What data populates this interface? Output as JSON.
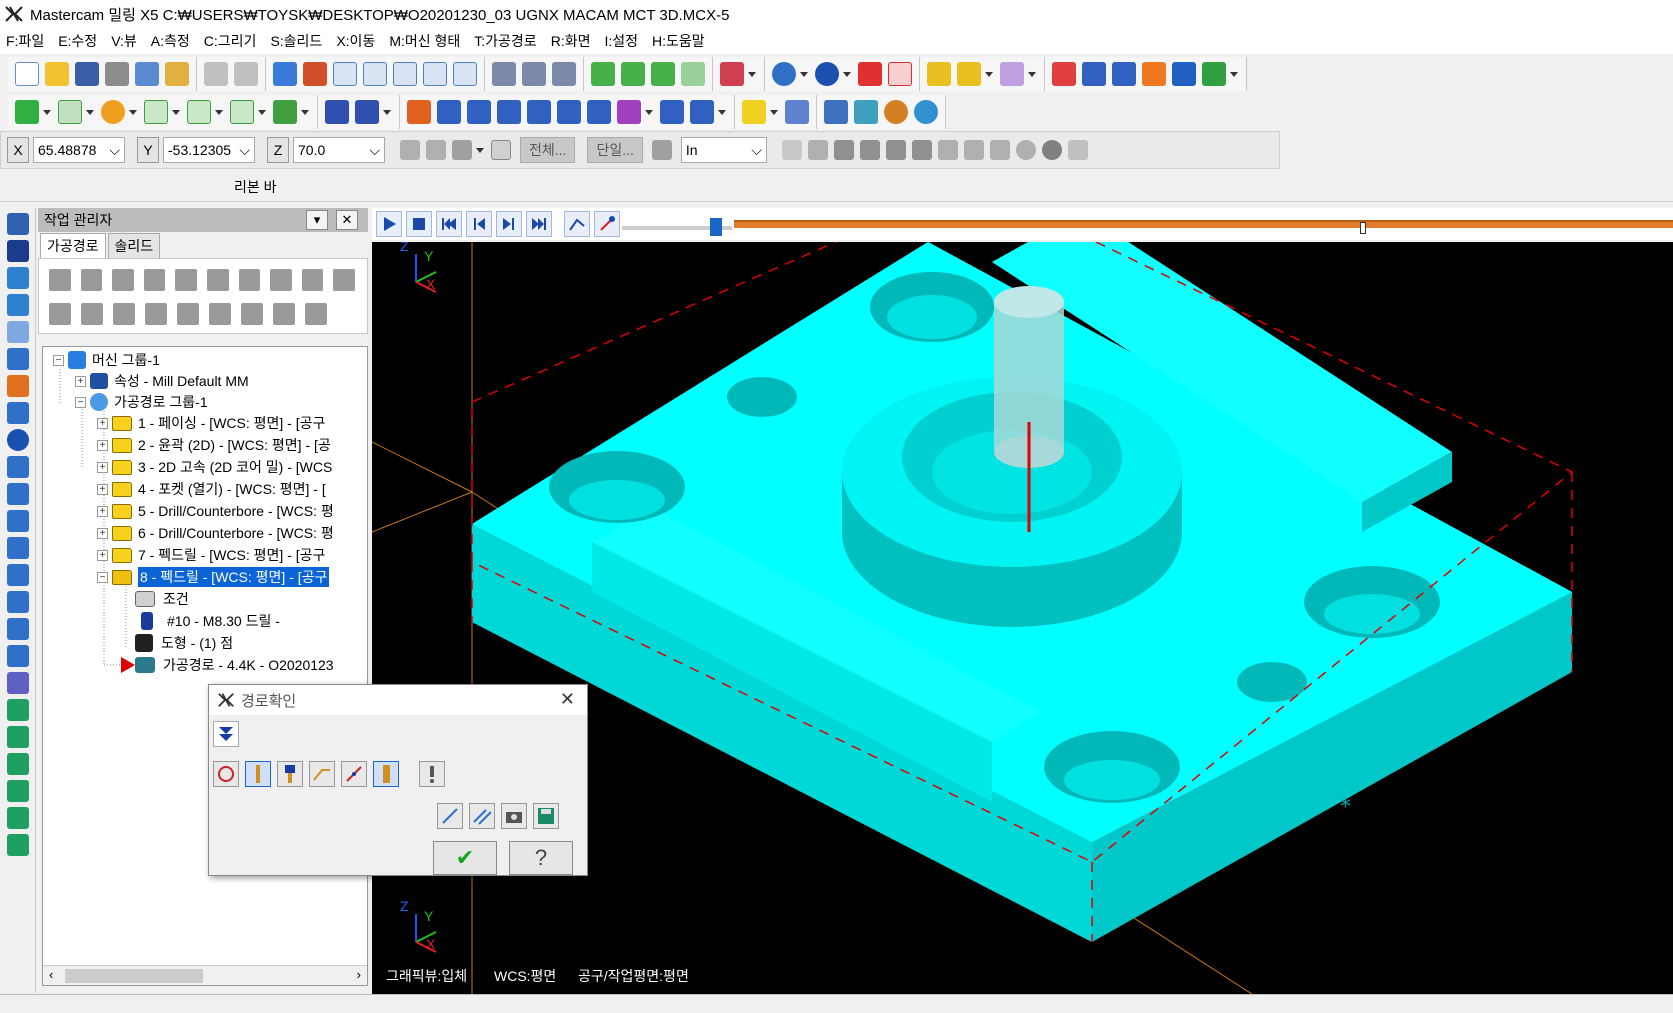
{
  "window": {
    "title": "Mastercam 밀링 X5  C:₩USERS₩TOYSK₩DESKTOP₩O20201230_03 UGNX MACAM MCT 3D.MCX-5"
  },
  "menu": {
    "items": [
      "F:파일",
      "E:수정",
      "V:뷰",
      "A:측정",
      "C:그리기",
      "S:솔리드",
      "X:이동",
      "M:머신 형태",
      "T:가공경로",
      "R:화면",
      "I:설정",
      "H:도움말"
    ]
  },
  "coords": {
    "x_label": "X",
    "x_value": "65.48878",
    "y_label": "Y",
    "y_value": "-53.12305",
    "z_label": "Z",
    "z_value": "70.0",
    "all_button": "전체...",
    "single_button": "단일...",
    "unit_value": "In"
  },
  "ribbon": {
    "label": "리본 바"
  },
  "ops_manager": {
    "title": "작업 관리자",
    "tabs": [
      "가공경로",
      "솔리드"
    ],
    "tree": {
      "machine_group": "머신 그룹-1",
      "properties": "속성 - Mill Default MM",
      "toolpath_group": "가공경로 그룹-1",
      "operations": [
        "1 - 페이싱 - [WCS: 평면] - [공구",
        "2 - 윤곽 (2D) - [WCS: 평면] - [공",
        "3 - 2D 고속 (2D 코어 밀) - [WCS",
        "4 - 포켓 (열기) - [WCS: 평면] - [",
        "5 - Drill/Counterbore - [WCS: 평",
        "6 - Drill/Counterbore - [WCS: 평",
        "7 - 펙드릴 - [WCS: 평면] - [공구",
        "8 - 펙드릴 - [WCS: 평면] - [공구"
      ],
      "op8_children": [
        "조건",
        "#10 - M8.30 드릴 -",
        "도형 - (1) 점",
        "가공경로 - 4.4K - O2020123"
      ]
    }
  },
  "dialog": {
    "title": "경로확인",
    "ok_symbol": "✔",
    "help_symbol": "?"
  },
  "viewport": {
    "status_graphics": "그래픽뷰:입체",
    "status_wcs": "WCS:평면",
    "status_plane": "공구/작업평면:평면",
    "axis_x": "X",
    "axis_y": "Y",
    "axis_z": "Z"
  },
  "colors": {
    "part": "#00ffff",
    "background": "#000000",
    "selection": "#0a64d6",
    "timeline": "#e07b2a"
  }
}
